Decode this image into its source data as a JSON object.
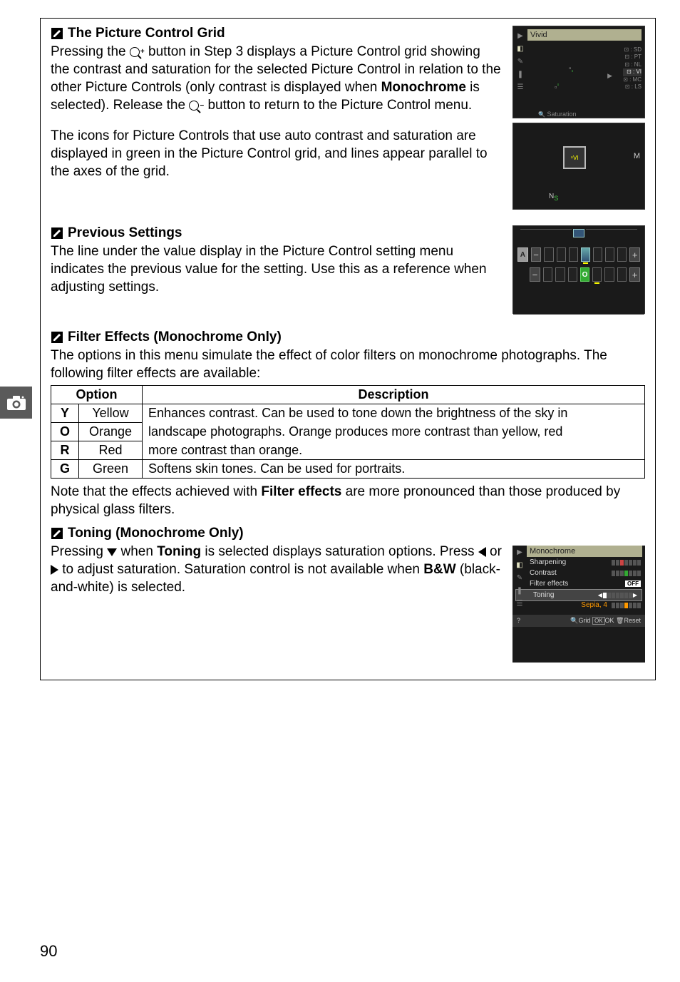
{
  "page_number": "90",
  "sidebar_icon": "camera-icon",
  "sections": {
    "grid": {
      "title": "The Picture Control Grid",
      "p1_a": "Pressing the ",
      "mag_in": "zoom-in-button",
      "p1_b": " button in Step 3 displays a Picture Control grid showing the contrast and saturation for the selected Picture Control in relation to the other Picture Controls (only contrast is displayed when ",
      "p1_bold": "Monochrome",
      "p1_c": " is selected).  Release the ",
      "mag_out": "zoom-out-button",
      "p1_d": " button to return to the Picture Control menu.",
      "p2": "The icons for Picture Controls that use auto contrast and saturation are displayed in green in the Picture Control grid, and lines appear parallel to the axes of the grid.",
      "lcd_title": "Vivid",
      "lcd_sat": "Saturation",
      "lcd_letters": {
        "m": "M",
        "n": "N",
        "s": "S"
      },
      "lcd_side": [
        "SD",
        "PT",
        "NL",
        "VI",
        "MC",
        "LS"
      ]
    },
    "prev": {
      "title": "Previous Settings",
      "p": "The line under the value display in the Picture Control setting menu indicates the previous value for the setting.  Use this as a reference when adjusting settings.",
      "auto_label": "A",
      "zero_label": "O"
    },
    "filter": {
      "title": "Filter Effects (Monochrome Only)",
      "p": "The options in this menu simulate the effect of color filters on monochrome photographs.  The following filter effects are available:",
      "table": {
        "h_option": "Option",
        "h_desc": "Description",
        "rows": [
          {
            "letter": "Y",
            "name": "Yellow",
            "desc": "Enhances contrast.  Can be used to tone down the brightness of the sky in "
          },
          {
            "letter": "O",
            "name": "Orange",
            "desc": "landscape photographs.  Orange produces more contrast than yellow, red "
          },
          {
            "letter": "R",
            "name": "Red",
            "desc": "more contrast than orange."
          },
          {
            "letter": "G",
            "name": "Green",
            "desc": "Softens skin tones.  Can be used for portraits."
          }
        ]
      },
      "note_a": "Note that the effects achieved with ",
      "note_bold": "Filter effects",
      "note_b": " are more pronounced than those produced by physical glass filters."
    },
    "toning": {
      "title": "Toning (Monochrome Only)",
      "p_a": "Pressing ",
      "tri_down": "down-arrow",
      "p_b": " when ",
      "p_bold1": "Toning",
      "p_c": " is selected displays saturation options.  Press ",
      "tri_left": "left-arrow",
      "p_or": " or ",
      "tri_right": "right-arrow",
      "p_d": " to adjust saturation.  Saturation control is not available when ",
      "p_bold2": "B&W",
      "p_e": " (black-and-white) is selected.",
      "lcd": {
        "title": "Monochrome",
        "rows": [
          {
            "label": "Sharpening"
          },
          {
            "label": "Contrast"
          },
          {
            "label": "Filter effects",
            "tag": "OFF"
          },
          {
            "label": "Toning"
          }
        ],
        "sepia": "Sepia, 4",
        "footer": {
          "grid": "Grid",
          "ok": "OK",
          "oklabel": "OK",
          "reset": "Reset"
        }
      }
    }
  }
}
